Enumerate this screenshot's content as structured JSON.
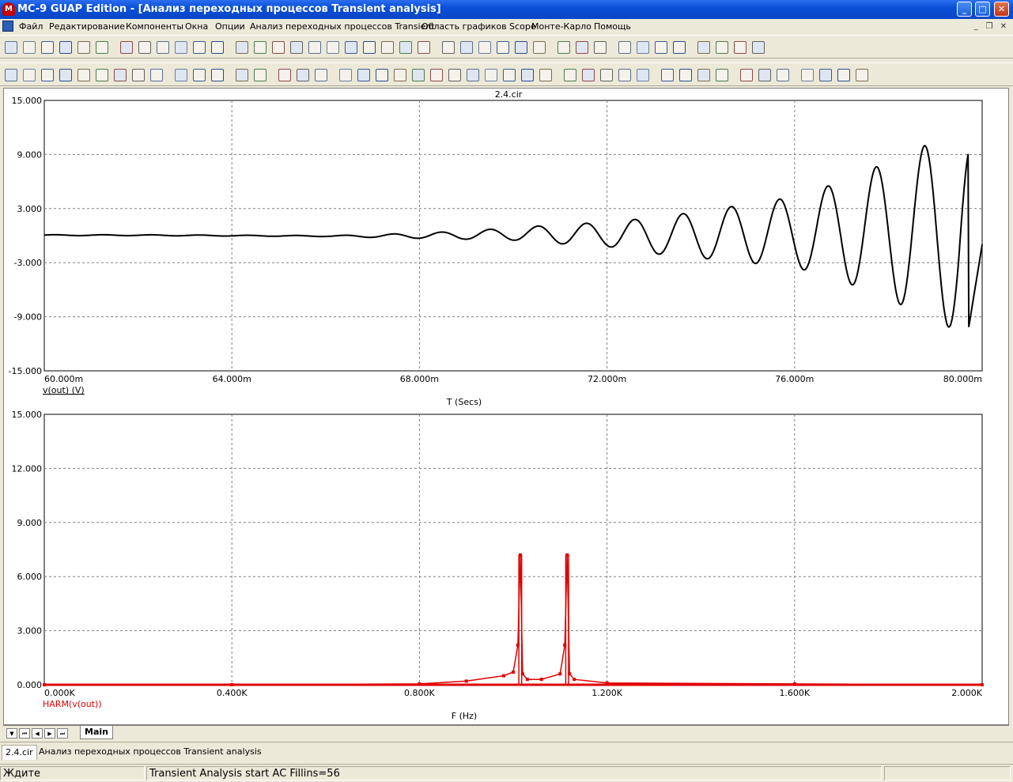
{
  "window": {
    "app_icon_letter": "M",
    "title": "MC-9 GUAP Edition - [Анализ переходных процессов Transient analysis]",
    "min_label": "_",
    "max_label": "□",
    "close_label": "✕"
  },
  "menu": {
    "items": [
      "Файл",
      "Редактирование",
      "Компоненты",
      "Окна",
      "Опции",
      "Анализ переходных процессов Transient",
      "Область графиков Scope",
      "Монте-Карло",
      "Помощь"
    ],
    "mdi_minimize": "_",
    "mdi_restore": "❐",
    "mdi_close": "✕"
  },
  "toolbar_icons": {
    "row1": [
      "new-file-icon",
      "open-folder-icon",
      "save-icon",
      "save-all-icon",
      "print-icon",
      "print-preview-icon",
      "undo-icon",
      "redo-icon",
      "cut-icon",
      "copy-icon",
      "paste-icon",
      "delete-icon",
      "ground-icon",
      "resistor-icon",
      "capacitor-icon",
      "inductor-icon",
      "diode-icon",
      "transistor-icon",
      "npn-icon",
      "opamp-icon",
      "battery-icon",
      "source-icon",
      "ac-source-icon",
      "text-all-icon",
      "tile-horizontal-icon",
      "tile-vertical-icon",
      "cascade-icon",
      "window-icon",
      "window-split-icon",
      "calculator-icon",
      "p-letter-icon",
      "g-letter-icon",
      "component-editor-icon",
      "grid-icon",
      "waveform-icon",
      "probe-icon",
      "pen-icon",
      "scope-icon",
      "vd-icon",
      "zoom-window-icon"
    ],
    "row2": [
      "select-arrow-icon",
      "select-tool-icon",
      "wire-icon",
      "component-tool-icon",
      "bus-icon",
      "label-icon",
      "graphics-icon",
      "t-text-icon",
      "info-icon",
      "run-icon",
      "stop-icon",
      "pause-icon",
      "add-curve-icon",
      "delete-curve-icon",
      "grid-toggle-icon",
      "minor-grid-icon",
      "axis-icon",
      "plot-x-icon",
      "plot-y-icon",
      "plot-xy-icon",
      "tracker-icon",
      "slope-icon",
      "peak-icon",
      "valley-icon",
      "high-icon",
      "low-icon",
      "inflection-icon",
      "global-high-icon",
      "global-low-icon",
      "cursor-left-icon",
      "cursor-right-icon",
      "rise-icon",
      "fall-icon",
      "data-points-icon",
      "tokens-icon",
      "text-mode-icon",
      "palette-icon",
      "properties-icon",
      "p-icon",
      "scale-icon",
      "auto-scale-icon",
      "zoom-in-icon",
      "zoom-out-icon",
      "globe-icon",
      "f-icon"
    ]
  },
  "plot1": {
    "title": "2.4.cir",
    "waveform_label": "v(out) (V)",
    "x_title": "T (Secs)",
    "y_ticks": [
      "15.000",
      "9.000",
      "3.000",
      "-3.000",
      "-9.000",
      "-15.000"
    ],
    "x_ticks": [
      "60.000m",
      "64.000m",
      "68.000m",
      "72.000m",
      "76.000m",
      "80.000m"
    ],
    "color": "#000000"
  },
  "plot2": {
    "waveform_label": "HARM(v(out))",
    "x_title": "F (Hz)",
    "y_ticks": [
      "15.000",
      "12.000",
      "9.000",
      "6.000",
      "3.000",
      "0.000"
    ],
    "x_ticks": [
      "0.000K",
      "0.400K",
      "0.800K",
      "1.200K",
      "1.600K",
      "2.000K"
    ],
    "color": "#e00000"
  },
  "chart_data": [
    {
      "type": "line",
      "title": "2.4.cir",
      "xlabel": "T (Secs)",
      "ylabel": "v(out) (V)",
      "xlim": [
        0.06,
        0.08
      ],
      "ylim": [
        -15,
        15
      ],
      "grid": true,
      "series": [
        {
          "name": "v(out) (V)",
          "x": [
            0.06,
            0.062,
            0.064,
            0.066,
            0.067,
            0.068,
            0.069,
            0.07,
            0.071,
            0.072,
            0.073,
            0.074,
            0.075,
            0.076,
            0.077,
            0.078,
            0.079,
            0.0795,
            0.08
          ],
          "y_envelope_upper": [
            0.1,
            0.1,
            0.05,
            0.0,
            0.1,
            0.3,
            0.5,
            0.9,
            1.2,
            1.5,
            2.0,
            2.7,
            3.5,
            4.3,
            6.0,
            8.2,
            10.5,
            10.7,
            10.5
          ],
          "y_envelope_lower": [
            0.0,
            0.0,
            -0.05,
            -0.1,
            -0.2,
            -0.3,
            -0.4,
            -0.5,
            -0.9,
            -1.2,
            -2.0,
            -2.5,
            -3.0,
            -3.5,
            -5.0,
            -7.0,
            -9.5,
            -10.6,
            -1.0
          ],
          "cycle_peaks_x": [
            0.0698,
            0.072,
            0.073,
            0.074,
            0.0751,
            0.0761,
            0.0772,
            0.0782,
            0.0792
          ],
          "cycle_peaks_y": [
            0.9,
            1.3,
            1.8,
            2.6,
            3.5,
            4.3,
            5.8,
            8.2,
            10.6
          ],
          "cycle_troughs_x": [
            0.0709,
            0.0725,
            0.0735,
            0.0746,
            0.0756,
            0.0766,
            0.0777,
            0.0787,
            0.0797
          ],
          "cycle_troughs_y": [
            -0.3,
            -1.0,
            -1.6,
            -2.5,
            -3.1,
            -4.6,
            -7.0,
            -9.4,
            -10.6
          ]
        }
      ]
    },
    {
      "type": "line",
      "xlabel": "F (Hz)",
      "ylabel": "HARM(v(out))",
      "xlim": [
        0,
        2000
      ],
      "ylim": [
        0,
        15
      ],
      "grid": true,
      "series": [
        {
          "name": "HARM(v(out))",
          "x": [
            0,
            400,
            800,
            900,
            980,
            1000,
            1010,
            1015,
            1020,
            1030,
            1060,
            1100,
            1110,
            1115,
            1120,
            1130,
            1200,
            1600,
            2000
          ],
          "y": [
            0.0,
            0.0,
            0.05,
            0.2,
            0.5,
            0.7,
            2.2,
            7.2,
            0.6,
            0.3,
            0.3,
            0.6,
            2.2,
            7.2,
            0.6,
            0.3,
            0.1,
            0.05,
            0.0
          ]
        }
      ]
    }
  ],
  "sheet": {
    "nav_first": "⏮",
    "nav_prev": "◀",
    "nav_next": "▶",
    "nav_last": "⏭",
    "menu_arrow": "▼",
    "tab_label": "Main"
  },
  "doc_tabs": [
    "2.4.cir",
    "Анализ переходных процессов Transient analysis"
  ],
  "status": {
    "left": "Ждите",
    "main": "Transient Analysis start AC Fillins=56"
  }
}
